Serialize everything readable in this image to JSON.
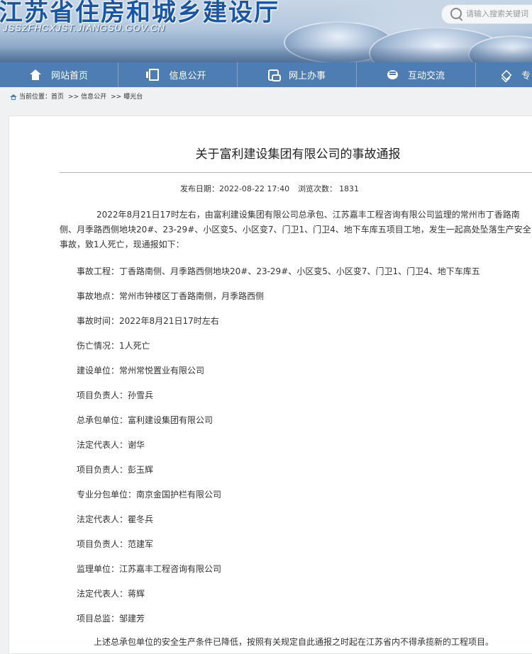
{
  "header": {
    "site_title": "江苏省住房和城乡建设厅",
    "site_url": "JSSZFHCXJST.JIANGSU.GOV.CN",
    "search_placeholder": "请输入搜索关键词"
  },
  "nav": {
    "items": [
      {
        "label": "网站首页",
        "icon": "home-icon"
      },
      {
        "label": "信息公开",
        "icon": "document-icon"
      },
      {
        "label": "网上办事",
        "icon": "service-icon"
      },
      {
        "label": "互动交流",
        "icon": "chat-icon"
      },
      {
        "label": "专",
        "icon": "layers-icon"
      }
    ]
  },
  "breadcrumb": {
    "prefix": "当前位置：",
    "items": [
      "首页",
      "信息公开",
      "曝光台"
    ]
  },
  "article": {
    "title": "关于富利建设集团有限公司的事故通报",
    "publish_label": "发布日期：",
    "publish_date": "2022-08-22 17:40",
    "views_label": "浏览次数：",
    "views": "1831",
    "intro": "2022年8月21日17时左右，由富利建设集团有限公司总承包、江苏嘉丰工程咨询有限公司监理的常州市丁香路南侧、月季路西侧地块20#、23-29#、小区变5、小区变7、门卫1、门卫4、地下车库五项目工地，发生一起高处坠落生产安全事故，致1人死亡，现通报如下：",
    "fields": [
      "事故工程：丁香路南侧、月季路西侧地块20#、23-29#、小区变5、小区变7、门卫1、门卫4、地下车库五",
      "事故地点：常州市钟楼区丁香路南侧，月季路西侧",
      "事故时间：2022年8月21日17时左右",
      "伤亡情况：1人死亡",
      "建设单位：常州常悦置业有限公司",
      "项目负责人：孙雪兵",
      "总承包单位：富利建设集团有限公司",
      "法定代表人：谢华",
      "项目负责人：彭玉辉",
      "专业分包单位：南京金国护栏有限公司",
      "法定代表人：瞿冬兵",
      "项目负责人：范建军",
      "监理单位：江苏嘉丰工程咨询有限公司",
      "法定代表人：蒋辉",
      "项目总监：邹建芳"
    ],
    "closing": "上述总承包单位的安全生产条件已降低，按照有关规定自此通报之时起在江苏省内不得承揽新的工程项目。"
  },
  "colors": {
    "nav_bg": "#4d7db3",
    "title_blue": "#1a56a8"
  }
}
